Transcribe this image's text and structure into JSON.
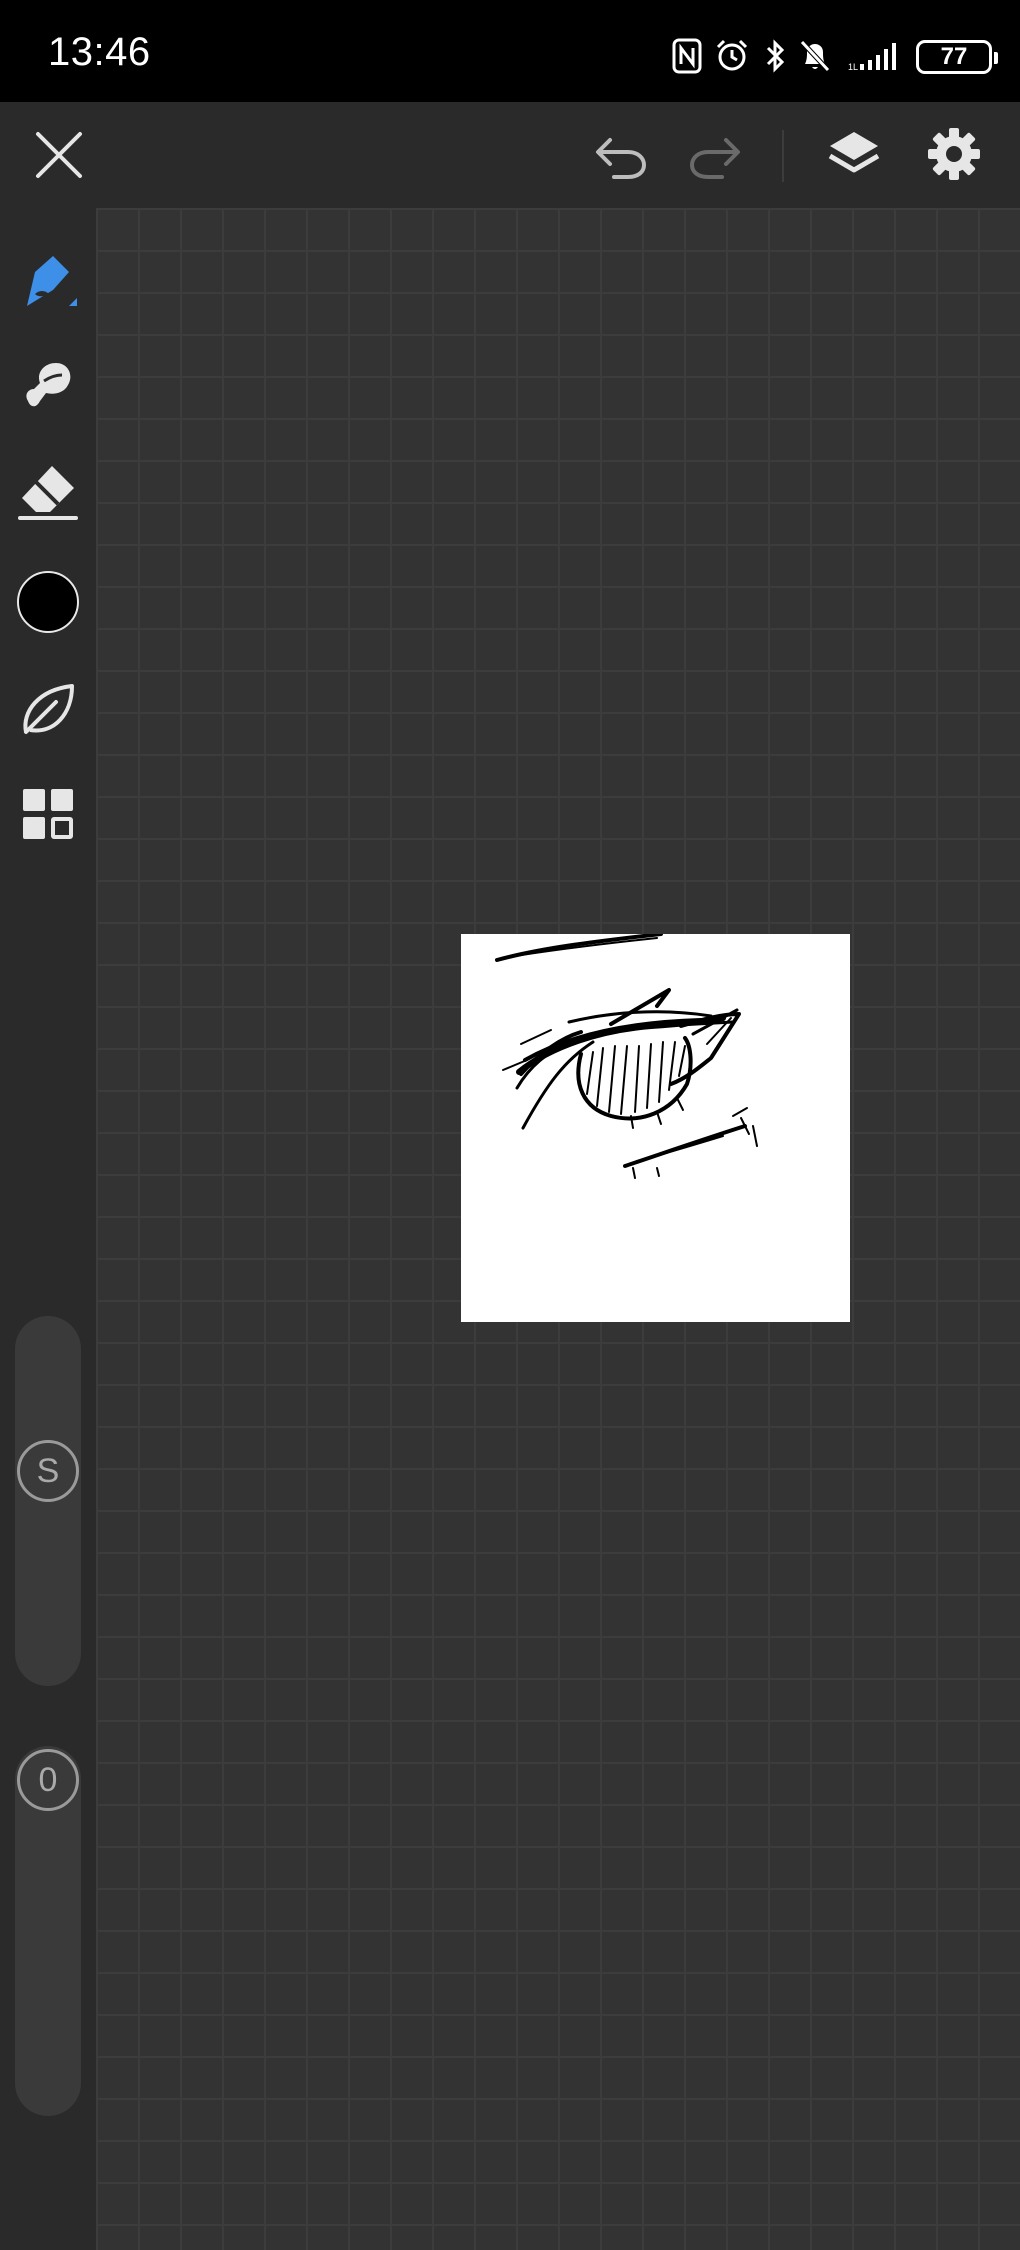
{
  "status_bar": {
    "time": "13:46",
    "battery": "77",
    "icons": [
      "nfc-icon",
      "alarm-icon",
      "bluetooth-icon",
      "mute-icon",
      "signal-icon",
      "battery-icon"
    ]
  },
  "toolbar": {
    "buttons": [
      "close-icon",
      "undo-icon",
      "redo-icon",
      "layers-icon",
      "settings-icon"
    ]
  },
  "left_rail": {
    "tools": [
      "pen-tool-icon",
      "smudge-tool-icon",
      "eraser-tool-icon",
      "color-swatch",
      "leaf-tool-icon",
      "grid-menu-icon"
    ],
    "active_tool": "pen",
    "brush_color": "#000000",
    "size_slider_label": "S",
    "opacity_slider_label": "0"
  },
  "colors": {
    "accent": "#3d8fe8",
    "canvas_bg": "#333333",
    "panel_bg": "#2a2a2a",
    "paper": "#ffffff"
  }
}
